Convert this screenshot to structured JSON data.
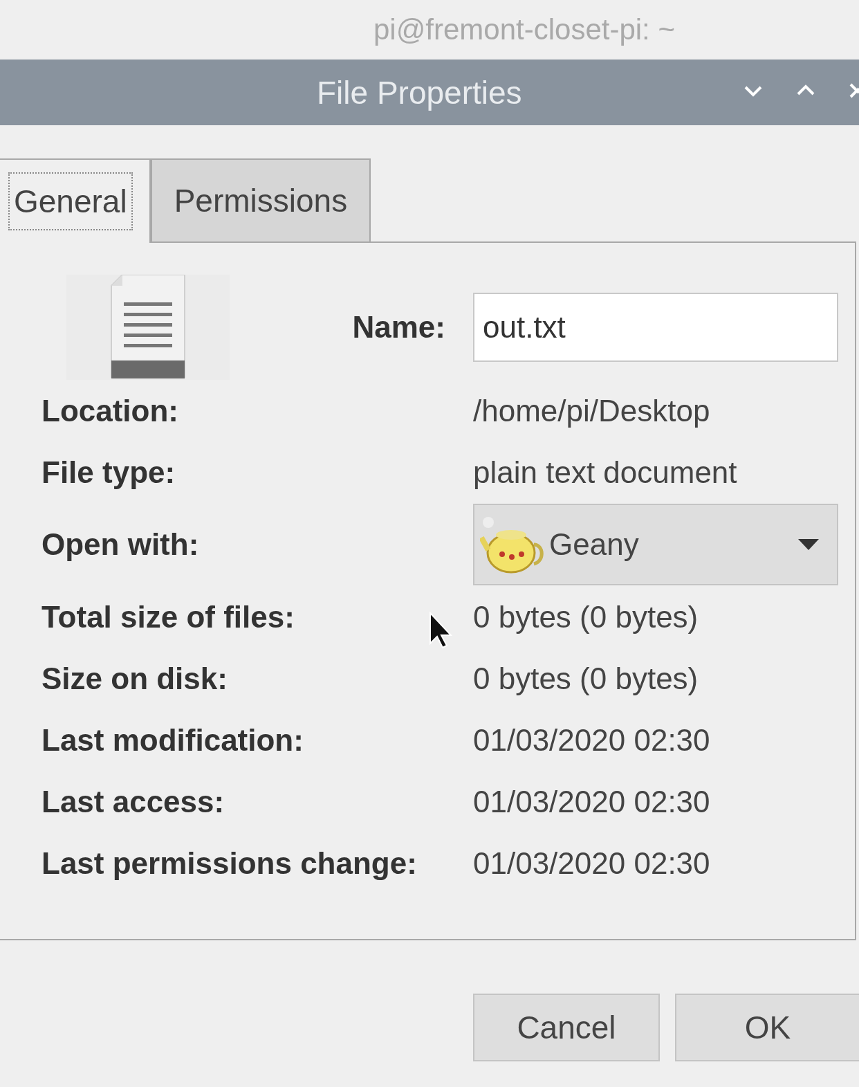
{
  "terminal_title": "pi@fremont-closet-pi: ~",
  "dialog": {
    "title": "File Properties"
  },
  "tabs": [
    {
      "label": "General",
      "selected": true
    },
    {
      "label": "Permissions",
      "selected": false
    }
  ],
  "name": {
    "label": "Name:",
    "value": "out.txt"
  },
  "fields": [
    {
      "kind": "text",
      "label": "Location:",
      "value": "/home/pi/Desktop"
    },
    {
      "kind": "text",
      "label": "File type:",
      "value": "plain text document"
    },
    {
      "kind": "select",
      "label": "Open with:",
      "value": "Geany"
    },
    {
      "kind": "text",
      "label": "Total size of files:",
      "value": "0 bytes (0 bytes)"
    },
    {
      "kind": "text",
      "label": "Size on disk:",
      "value": "0 bytes (0 bytes)"
    },
    {
      "kind": "text",
      "label": "Last modification:",
      "value": "01/03/2020 02:30"
    },
    {
      "kind": "text",
      "label": "Last access:",
      "value": "01/03/2020 02:30"
    },
    {
      "kind": "text",
      "label": "Last permissions change:",
      "value": "01/03/2020 02:30"
    }
  ],
  "buttons": [
    "Cancel",
    "OK"
  ]
}
